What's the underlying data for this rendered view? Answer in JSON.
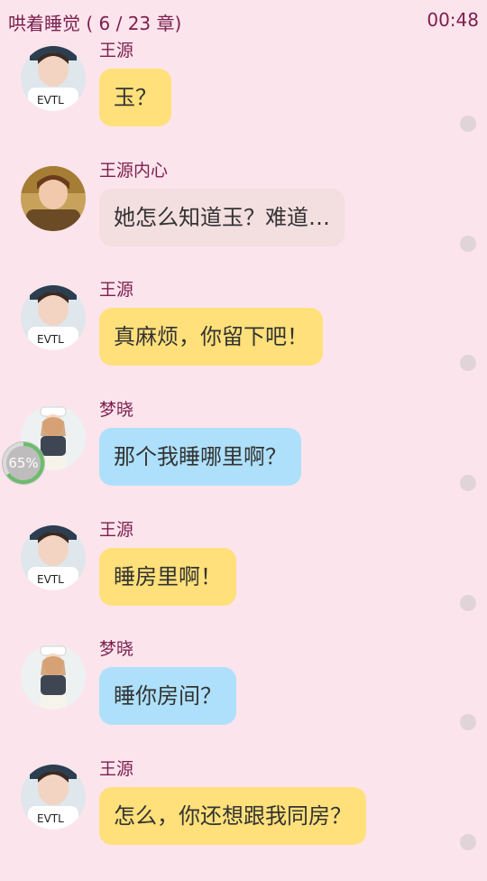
{
  "header": {
    "title": "哄着睡觉 ( 6 / 23 章)",
    "time": "00:48"
  },
  "messages": [
    {
      "speaker": "王源",
      "text": "玉？",
      "style": "yellow",
      "avatar": "wangyuan-avatar"
    },
    {
      "speaker": "王源内心",
      "text": "她怎么知道玉？难道…",
      "style": "pink",
      "avatar": "wangyuan-inner-avatar"
    },
    {
      "speaker": "王源",
      "text": "真麻烦，你留下吧！",
      "style": "yellow",
      "avatar": "wangyuan-avatar"
    },
    {
      "speaker": "梦晓",
      "text": "那个我睡哪里啊？",
      "style": "blue",
      "avatar": "mengxiao-avatar"
    },
    {
      "speaker": "王源",
      "text": "睡房里啊！",
      "style": "yellow",
      "avatar": "wangyuan-avatar"
    },
    {
      "speaker": "梦晓",
      "text": "睡你房间？",
      "style": "blue",
      "avatar": "mengxiao-avatar"
    },
    {
      "speaker": "王源",
      "text": "怎么，你还想跟我同房？",
      "style": "yellow",
      "avatar": "wangyuan-avatar"
    }
  ],
  "progress": {
    "label": "65%",
    "value": 0.65
  },
  "colors": {
    "background": "#fce4ec",
    "header_text": "#7b1f4e",
    "bubble_yellow": "#ffe07a",
    "bubble_pink": "#f3dee0",
    "bubble_blue": "#aee0fb"
  }
}
